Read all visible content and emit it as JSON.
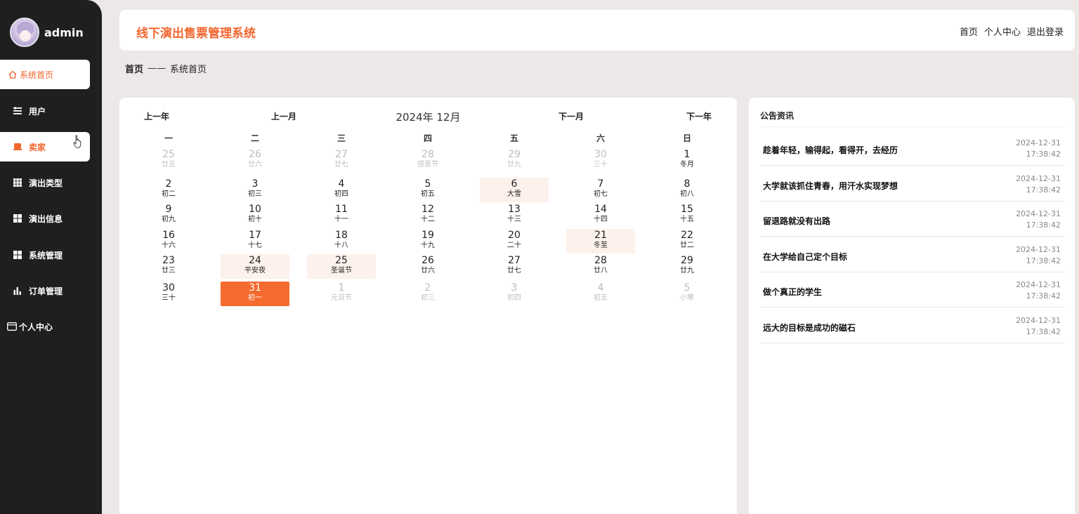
{
  "user": {
    "name": "admin"
  },
  "sidebar": {
    "items": [
      {
        "label": "系统首页",
        "icon": "home-icon"
      },
      {
        "label": "用户",
        "icon": "list-icon"
      },
      {
        "label": "卖家",
        "icon": "seat-icon"
      },
      {
        "label": "演出类型",
        "icon": "grid-icon"
      },
      {
        "label": "演出信息",
        "icon": "grid-icon"
      },
      {
        "label": "系统管理",
        "icon": "grid-icon"
      },
      {
        "label": "订单管理",
        "icon": "bar-chart-icon"
      },
      {
        "label": "个人中心",
        "icon": "id-card-icon"
      }
    ]
  },
  "header": {
    "title": "线下演出售票管理系统",
    "links": [
      "首页",
      "个人中心",
      "退出登录"
    ]
  },
  "breadcrumb": {
    "home": "首页",
    "sep": "——",
    "current": "系统首页"
  },
  "calendar": {
    "prev_year": "上一年",
    "prev_month": "上一月",
    "title": "2024年 12月",
    "next_month": "下一月",
    "next_year": "下一年",
    "weekdays": [
      "一",
      "二",
      "三",
      "四",
      "五",
      "六",
      "日"
    ],
    "weeks": [
      [
        {
          "n": "25",
          "l": "廿五",
          "other": true
        },
        {
          "n": "26",
          "l": "廿六",
          "other": true
        },
        {
          "n": "27",
          "l": "廿七",
          "other": true
        },
        {
          "n": "28",
          "l": "感恩节",
          "other": true
        },
        {
          "n": "29",
          "l": "廿九",
          "other": true
        },
        {
          "n": "30",
          "l": "三十",
          "other": true
        },
        {
          "n": "1",
          "l": "冬月"
        }
      ],
      [
        {
          "n": "2",
          "l": "初二"
        },
        {
          "n": "3",
          "l": "初三"
        },
        {
          "n": "4",
          "l": "初四"
        },
        {
          "n": "5",
          "l": "初五"
        },
        {
          "n": "6",
          "l": "大雪",
          "hl": true
        },
        {
          "n": "7",
          "l": "初七"
        },
        {
          "n": "8",
          "l": "初八"
        }
      ],
      [
        {
          "n": "9",
          "l": "初九"
        },
        {
          "n": "10",
          "l": "初十"
        },
        {
          "n": "11",
          "l": "十一"
        },
        {
          "n": "12",
          "l": "十二"
        },
        {
          "n": "13",
          "l": "十三"
        },
        {
          "n": "14",
          "l": "十四"
        },
        {
          "n": "15",
          "l": "十五"
        }
      ],
      [
        {
          "n": "16",
          "l": "十六"
        },
        {
          "n": "17",
          "l": "十七"
        },
        {
          "n": "18",
          "l": "十八"
        },
        {
          "n": "19",
          "l": "十九"
        },
        {
          "n": "20",
          "l": "二十"
        },
        {
          "n": "21",
          "l": "冬至",
          "hl": true
        },
        {
          "n": "22",
          "l": "廿二"
        }
      ],
      [
        {
          "n": "23",
          "l": "廿三"
        },
        {
          "n": "24",
          "l": "平安夜",
          "hl": true
        },
        {
          "n": "25",
          "l": "圣诞节",
          "hl": true
        },
        {
          "n": "26",
          "l": "廿六"
        },
        {
          "n": "27",
          "l": "廿七"
        },
        {
          "n": "28",
          "l": "廿八"
        },
        {
          "n": "29",
          "l": "廿九"
        }
      ],
      [
        {
          "n": "30",
          "l": "三十"
        },
        {
          "n": "31",
          "l": "初一",
          "today": true
        },
        {
          "n": "1",
          "l": "元旦节",
          "other": true
        },
        {
          "n": "2",
          "l": "初三",
          "other": true
        },
        {
          "n": "3",
          "l": "初四",
          "other": true
        },
        {
          "n": "4",
          "l": "初五",
          "other": true
        },
        {
          "n": "5",
          "l": "小寒",
          "other": true
        }
      ]
    ]
  },
  "notices": {
    "title": "公告资讯",
    "items": [
      {
        "text": "趁着年轻，输得起，看得开，去经历",
        "date": "2024-12-31",
        "time": "17:38:42"
      },
      {
        "text": "大学就该抓住青春，用汗水实现梦想",
        "date": "2024-12-31",
        "time": "17:38:42"
      },
      {
        "text": "留退路就没有出路",
        "date": "2024-12-31",
        "time": "17:38:42"
      },
      {
        "text": "在大学给自己定个目标",
        "date": "2024-12-31",
        "time": "17:38:42"
      },
      {
        "text": "做个真正的学生",
        "date": "2024-12-31",
        "time": "17:38:42"
      },
      {
        "text": "远大的目标是成功的磁石",
        "date": "2024-12-31",
        "time": "17:38:42"
      }
    ]
  },
  "colors": {
    "accent": "#f2662e",
    "sidebar": "#1f1f1f",
    "highlight": "#fdf1ec"
  }
}
